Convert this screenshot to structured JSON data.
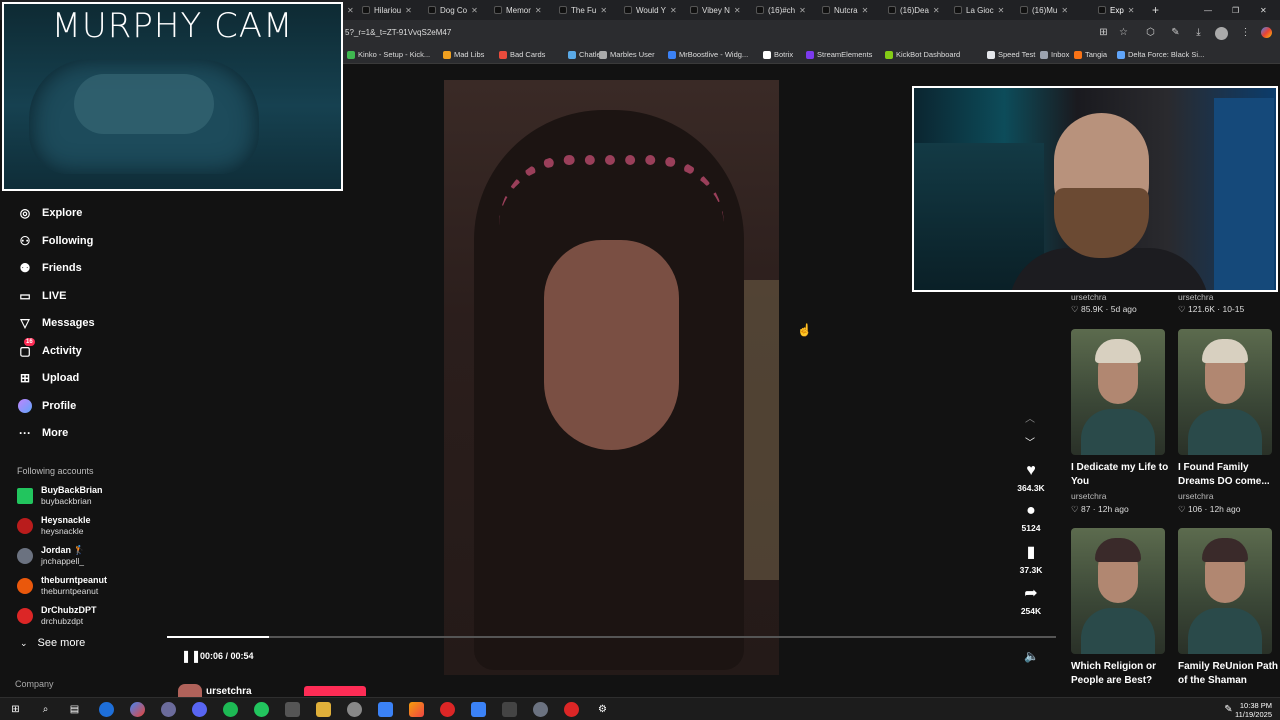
{
  "browser": {
    "tabs": [
      {
        "label": "Hilariou"
      },
      {
        "label": "Dog Co"
      },
      {
        "label": "Memor"
      },
      {
        "label": "The Fu"
      },
      {
        "label": "Would Y"
      },
      {
        "label": "Vibey N"
      },
      {
        "label": "(16)#ch"
      },
      {
        "label": "Nutcra"
      },
      {
        "label": "(16)Dea"
      },
      {
        "label": "La Gioc"
      },
      {
        "label": "(16)Mu"
      },
      {
        "label": "Exp"
      }
    ],
    "url": "5?_r=1&_t=ZT-91VvqS2eM47",
    "bookmarks": [
      {
        "label": "Kinko - Setup - Kick...",
        "color": "#3fb950"
      },
      {
        "label": "Mad Libs",
        "color": "#f0a020"
      },
      {
        "label": "Bad Cards",
        "color": "#e94b3c"
      },
      {
        "label": "Chatle",
        "color": "#5aa9e6"
      },
      {
        "label": "Marbles User",
        "color": "#aaaaaa"
      },
      {
        "label": "MrBoostlive - Widg...",
        "color": "#3b82f6"
      },
      {
        "label": "Botrix",
        "color": "#ffffff"
      },
      {
        "label": "StreamElements",
        "color": "#7c3aed"
      },
      {
        "label": "KickBot Dashboard",
        "color": "#84cc16"
      },
      {
        "label": "Speed Test",
        "color": "#e5e7eb"
      },
      {
        "label": "Inbox",
        "color": "#9ca3af"
      },
      {
        "label": "Tangia",
        "color": "#f97316"
      },
      {
        "label": "Delta Force: Black Si...",
        "color": "#60a5fa"
      }
    ]
  },
  "overlay": {
    "murphy_title": "MURPHY CAM"
  },
  "nav": [
    {
      "label": "Explore",
      "icon": "compass-icon"
    },
    {
      "label": "Following",
      "icon": "following-icon"
    },
    {
      "label": "Friends",
      "icon": "friends-icon"
    },
    {
      "label": "LIVE",
      "icon": "live-icon"
    },
    {
      "label": "Messages",
      "icon": "messages-icon"
    },
    {
      "label": "Activity",
      "icon": "activity-icon",
      "badge": "16"
    },
    {
      "label": "Upload",
      "icon": "upload-icon"
    },
    {
      "label": "Profile",
      "icon": "profile-icon"
    },
    {
      "label": "More",
      "icon": "more-icon"
    }
  ],
  "following": {
    "heading": "Following accounts",
    "accounts": [
      {
        "name": "BuyBackBrian",
        "handle": "buybackbrian",
        "color": "#22c55e"
      },
      {
        "name": "Heysnackle",
        "handle": "heysnackle",
        "color": "#b91c1c"
      },
      {
        "name": "Jordan 🏌",
        "handle": "jnchappell_",
        "color": "#6b7280"
      },
      {
        "name": "theburntpeanut",
        "handle": "theburntpeanut",
        "color": "#ea580c"
      },
      {
        "name": "DrChubzDPT",
        "handle": "drchubzdpt",
        "color": "#dc2626"
      }
    ],
    "see_more": "See more"
  },
  "footer": {
    "company": "Company"
  },
  "player": {
    "time": "00:06 / 00:54",
    "progress": 0.115,
    "creator": "ursetchra"
  },
  "actions": {
    "likes": "364.3K",
    "comments": "5124",
    "saves": "37.3K",
    "shares": "254K"
  },
  "recommended": {
    "top_row": [
      {
        "user": "ursetchra",
        "stat": "♡ 85.9K · 5d ago"
      },
      {
        "user": "ursetchra",
        "stat": "♡ 121.6K · 10-15"
      }
    ],
    "mid_row": [
      {
        "title": "I Dedicate my Life to You",
        "user": "ursetchra",
        "stat": "♡ 87 · 12h ago"
      },
      {
        "title": "I Found Family Dreams DO come...",
        "user": "ursetchra",
        "stat": "♡ 106 · 12h ago"
      }
    ],
    "bottom_row": [
      {
        "title": "Which Religion or People are Best?"
      },
      {
        "title": "Family ReUnion Path of the Shaman"
      }
    ]
  },
  "taskbar": {
    "time": "10:38 PM",
    "date": "11/19/2025"
  }
}
